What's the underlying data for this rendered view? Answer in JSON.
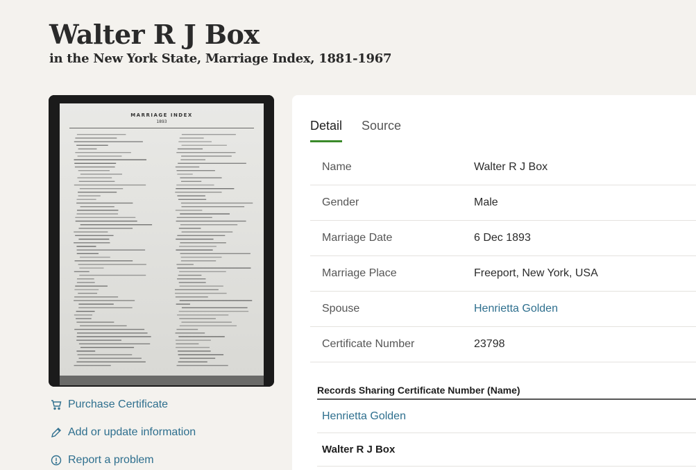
{
  "header": {
    "title": "Walter R J Box",
    "subtitle": "in the New York State, Marriage Index, 1881-1967"
  },
  "record_image": {
    "heading": "MARRIAGE INDEX",
    "year": "1893"
  },
  "actions": [
    {
      "label": "Purchase Certificate",
      "icon": "cart-icon"
    },
    {
      "label": "Add or update information",
      "icon": "pencil-icon"
    },
    {
      "label": "Report a problem",
      "icon": "alert-circle-icon"
    }
  ],
  "tabs": [
    {
      "label": "Detail",
      "active": true
    },
    {
      "label": "Source",
      "active": false
    }
  ],
  "details": [
    {
      "label": "Name",
      "value": "Walter R J Box"
    },
    {
      "label": "Gender",
      "value": "Male"
    },
    {
      "label": "Marriage Date",
      "value": "6 Dec 1893"
    },
    {
      "label": "Marriage Place",
      "value": "Freeport, New York, USA"
    },
    {
      "label": "Spouse",
      "value": "Henrietta Golden"
    },
    {
      "label": "Certificate Number",
      "value": "23798"
    }
  ],
  "sharing": {
    "heading": "Records Sharing Certificate Number (Name)",
    "items": [
      {
        "name": "Henrietta Golden"
      },
      {
        "name": "Walter R J Box"
      }
    ]
  },
  "colors": {
    "link": "#2e6f8e",
    "active_tab_underline": "#3a8a2a",
    "background": "#f4f2ee"
  }
}
